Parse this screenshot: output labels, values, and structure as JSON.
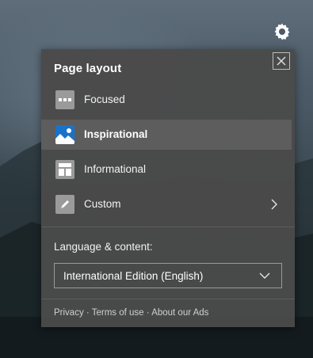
{
  "settings_icon": "gear-icon",
  "panel": {
    "title": "Page layout",
    "close_icon": "close-icon",
    "layouts": [
      {
        "label": "Focused",
        "icon": "focused-layout-icon",
        "selected": false
      },
      {
        "label": "Inspirational",
        "icon": "inspirational-layout-icon",
        "selected": true
      },
      {
        "label": "Informational",
        "icon": "informational-layout-icon",
        "selected": false
      },
      {
        "label": "Custom",
        "icon": "pencil-icon",
        "selected": false
      }
    ],
    "custom_chevron_icon": "chevron-right-icon",
    "language": {
      "label": "Language & content:",
      "selected": "International Edition (English)",
      "dropdown_icon": "chevron-down-icon"
    },
    "footer": {
      "privacy": "Privacy",
      "terms": "Terms of use",
      "ads": "About our Ads",
      "separator": "·"
    }
  },
  "colors": {
    "panel_bg": "#4a4a4a",
    "selected_bg": "#5d5d5d",
    "inspirational_icon_bg": "#1a73c8",
    "icon_tile_bg": "#9a9a9a"
  }
}
